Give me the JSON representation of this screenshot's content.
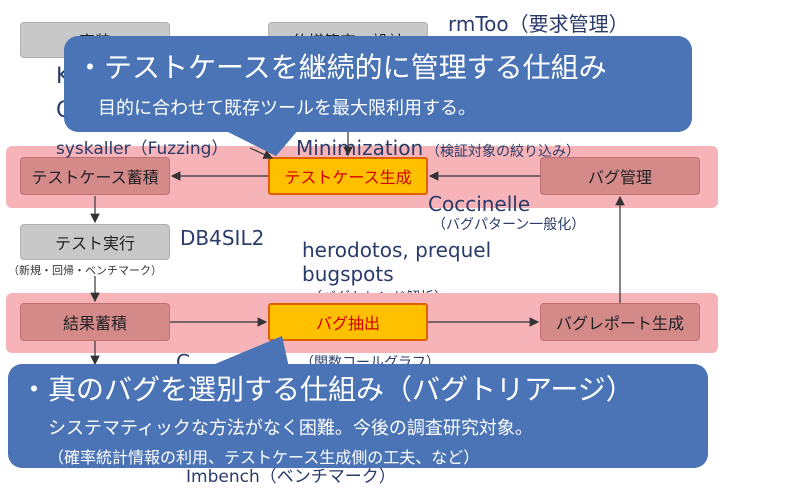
{
  "top_boxes": {
    "left_partial": "実装",
    "mid_partial": "仕様策定・設計"
  },
  "labels": {
    "rmtoo": "rmToo（要求管理）",
    "partial_k": "K",
    "partial_c": "C",
    "syskaller": "syskaller（Fuzzing）",
    "minimization": "Minimization",
    "minimization_note": "（検証対象の絞り込み）",
    "coccinelle": "Coccinelle",
    "coccinelle_note": "（バグパターン一般化）",
    "db4sil2": "DB4SIL2",
    "herodotos": "herodotos, prequel",
    "bugspots": "bugspots",
    "bugspots_note": "（バグトレンド解析）",
    "callgraph_note": "（関数コールグラフ）",
    "partial_c2": "C",
    "imbench": "Imbench（ベンチマーク）"
  },
  "lane1": {
    "test_store": "テストケース蓄積",
    "test_gen": "テストケース生成",
    "bug_mgmt": "バグ管理"
  },
  "middle": {
    "test_exec": "テスト実行",
    "test_exec_note": "（新規・回帰・ベンチマーク）"
  },
  "lane2": {
    "result_store": "結果蓄積",
    "bug_extract": "バグ抽出",
    "bug_report": "バグレポート生成"
  },
  "callout_top": {
    "headline": "・テストケースを継続的に管理する仕組み",
    "sub": "目的に合わせて既存ツールを最大限利用する。"
  },
  "callout_bottom": {
    "headline": "・真のバグを選別する仕組み（バグトリアージ）",
    "sub": "システマティックな方法がなく困難。今後の調査研究対象。",
    "sub2": "（確率統計情報の利用、テストケース生成側の工夫、など）"
  },
  "colors": {
    "lane": "#f6b4b8",
    "node_dark": "#d58a8a",
    "node_orange": "#ffc000",
    "callout": "#4a74b5",
    "label_text": "#2a3b6a"
  }
}
